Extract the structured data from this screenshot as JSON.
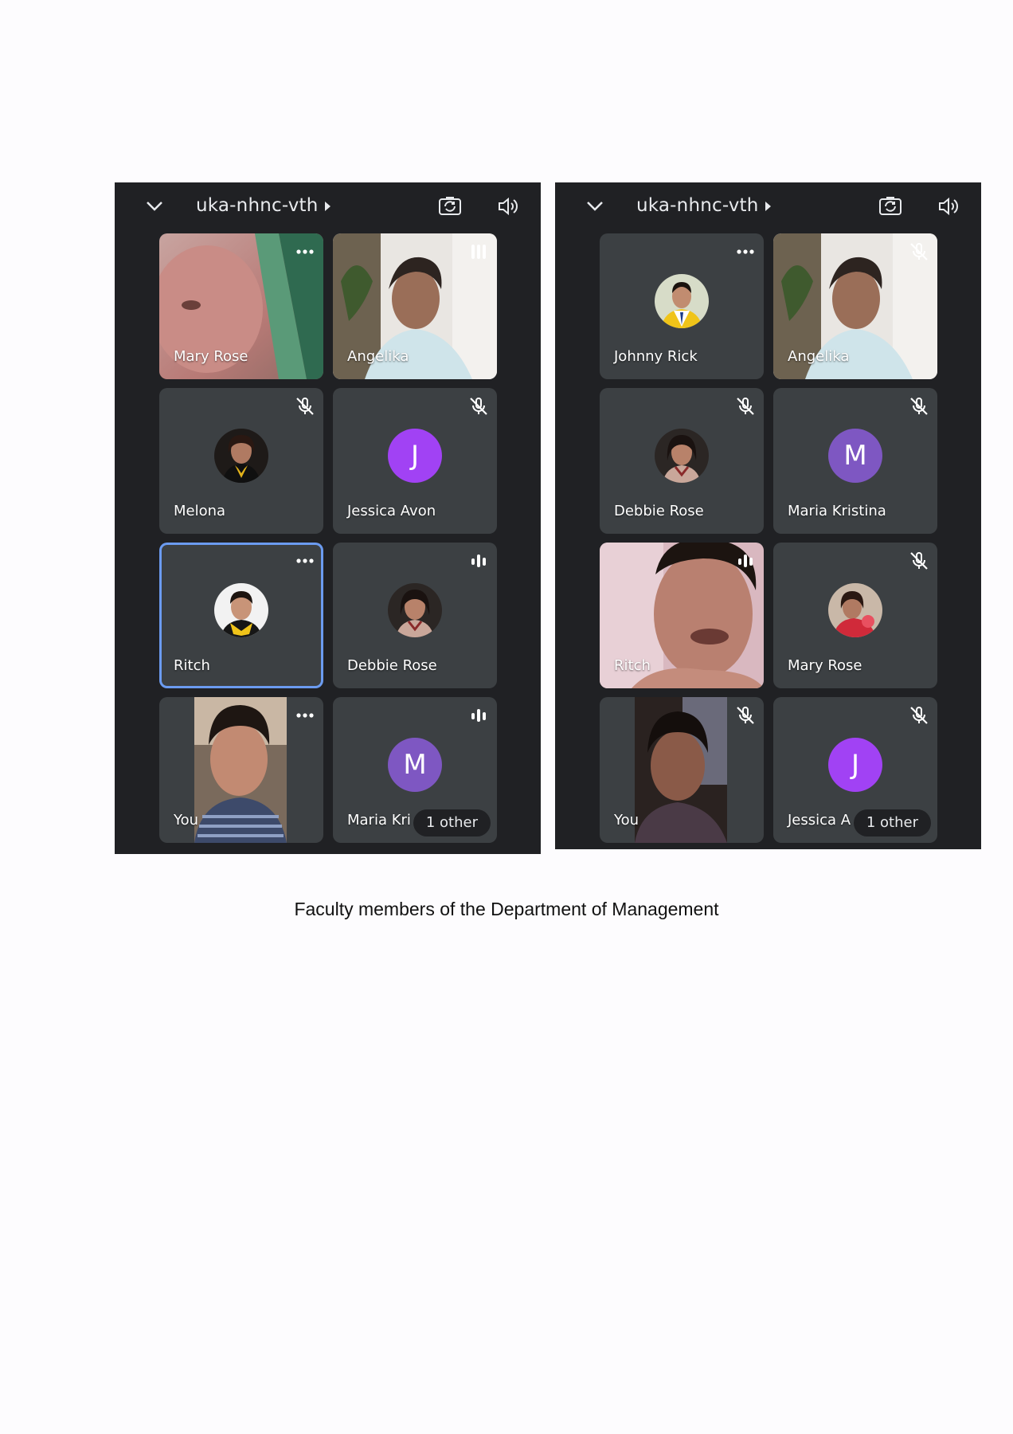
{
  "screenshots": [
    {
      "meeting_code": "uka-nhnc-vth",
      "tiles": [
        {
          "name": "Mary Rose",
          "indicator": "more-options",
          "kind": "video"
        },
        {
          "name": "Angelika",
          "indicator": "speaking",
          "kind": "video"
        },
        {
          "name": "Melona",
          "indicator": "muted",
          "kind": "photo"
        },
        {
          "name": "Jessica Avon",
          "indicator": "muted",
          "kind": "letter",
          "letter": "J",
          "color": "#a142f4"
        },
        {
          "name": "Ritch",
          "indicator": "more-options",
          "kind": "photo",
          "selected": true
        },
        {
          "name": "Debbie Rose",
          "indicator": "speaking",
          "kind": "photo"
        },
        {
          "name": "You",
          "indicator": "more-options",
          "kind": "self-video"
        },
        {
          "name": "Maria Kri",
          "indicator": "speaking",
          "kind": "letter",
          "letter": "M",
          "color": "#7e57c2",
          "extra": "1 other"
        }
      ]
    },
    {
      "meeting_code": "uka-nhnc-vth",
      "tiles": [
        {
          "name": "Johnny Rick",
          "indicator": "more-options",
          "kind": "photo"
        },
        {
          "name": "Angelika",
          "indicator": "muted",
          "kind": "video"
        },
        {
          "name": "Debbie Rose",
          "indicator": "muted",
          "kind": "photo"
        },
        {
          "name": "Maria Kristina",
          "indicator": "muted",
          "kind": "letter",
          "letter": "M",
          "color": "#7e57c2"
        },
        {
          "name": "Ritch",
          "indicator": "speaking",
          "kind": "video"
        },
        {
          "name": "Mary Rose",
          "indicator": "muted",
          "kind": "photo"
        },
        {
          "name": "You",
          "indicator": "muted",
          "kind": "self-video"
        },
        {
          "name": "Jessica A",
          "indicator": "muted",
          "kind": "letter",
          "letter": "J",
          "color": "#a142f4",
          "extra": "1 other"
        }
      ]
    }
  ],
  "caption": "Faculty members of the Department of Management"
}
